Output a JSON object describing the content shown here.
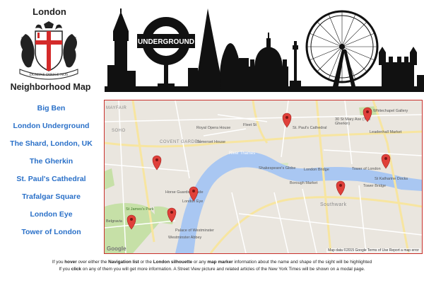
{
  "header": {
    "city": "London",
    "title": "Neighborhood Map"
  },
  "crest": {
    "motto": "DOMINE DIRIGE NOS"
  },
  "skyline": {
    "sign_text": "UNDERGROUND"
  },
  "nav": {
    "items": [
      "Big Ben",
      "London Underground",
      "The Shard, London, UK",
      "The Gherkin",
      "St. Paul's Cathedral",
      "Trafalgar Square",
      "London Eye",
      "Tower of London"
    ]
  },
  "map": {
    "labels": {
      "royal_opera": "Royal Opera House",
      "soho": "SOHO",
      "covent_garden": "COVENT GARDEN",
      "somerset": "Somerset House",
      "fleet_st": "Fleet St",
      "st_pauls": "St. Paul's Cathedral",
      "mary_axe": "30 St Mary Axe (The Gherkin)",
      "whitechapel": "Whitechapel Gallery",
      "leadenhall": "Leadenhall Market",
      "river_thames": "River Thames",
      "shakespeare": "Shakespeare's Globe",
      "london_bridge": "London Bridge",
      "tower": "Tower of London",
      "borough": "Borough Market",
      "tower_bridge": "Tower Bridge",
      "katharine": "St Katharine Docks",
      "horse_guards": "Horse Guards Parade",
      "london_eye": "London Eye",
      "st_james": "St James's Park",
      "palace": "Palace of Westminster",
      "abbey": "Westminster Abbey",
      "southwark": "Southwark",
      "mayfair": "MAYFAIR",
      "belgravia": "Belgravia"
    },
    "attribution": "Map data ©2015 Google   Terms of Use   Report a map error",
    "logo": "Google"
  },
  "footer": {
    "l1_a": "If you ",
    "l1_b": "hover",
    "l1_c": " over either the ",
    "l1_d": "Navigation list",
    "l1_e": " or the ",
    "l1_f": "London silhouette",
    "l1_g": " or any ",
    "l1_h": "map marker",
    "l1_i": " information about the name and shape of the sight will be highlighted",
    "l2_a": "If you ",
    "l2_b": "click",
    "l2_c": " on any of them you will get more information. A Street View picture and related articles of the New York Times will be shown on a modal page."
  },
  "colors": {
    "nav": "#2a70c8",
    "map_border": "#c9302c",
    "marker": "#e0403a",
    "water": "#a9c7f2",
    "park": "#c6e0a7"
  }
}
